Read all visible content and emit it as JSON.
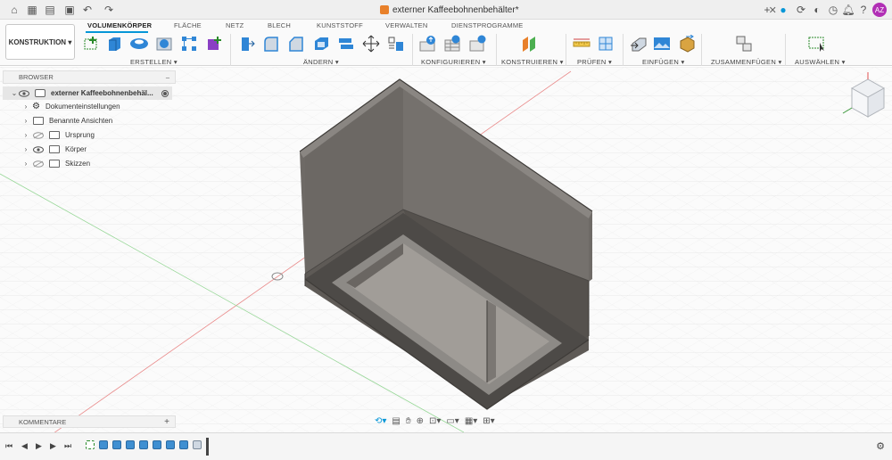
{
  "titlebar": {
    "document_title": "externer Kaffeebohnenbehälter*",
    "user_initials": "AZ"
  },
  "ribbon": {
    "workspace_button": "KONSTRUKTION",
    "tabs": [
      "VOLUMENKÖRPER",
      "FLÄCHE",
      "NETZ",
      "BLECH",
      "KUNSTSTOFF",
      "VERWALTEN",
      "DIENSTPROGRAMME"
    ],
    "groups": [
      "ERSTELLEN",
      "ÄNDERN",
      "KONFIGURIEREN",
      "KONSTRUIEREN",
      "PRÜFEN",
      "EINFÜGEN",
      "ZUSAMMENFÜGEN",
      "AUSWÄHLEN"
    ]
  },
  "browser": {
    "title": "BROWSER",
    "items": [
      {
        "label": "externer Kaffeebohnenbehäl..."
      },
      {
        "label": "Dokumenteinstellungen"
      },
      {
        "label": "Benannte Ansichten"
      },
      {
        "label": "Ursprung"
      },
      {
        "label": "Körper"
      },
      {
        "label": "Skizzen"
      }
    ]
  },
  "comments": {
    "title": "KOMMENTARE",
    "add": "+"
  },
  "colors": {
    "accent": "#0696d7",
    "body": "#6e6a66",
    "avatar": "#b12fb5"
  }
}
